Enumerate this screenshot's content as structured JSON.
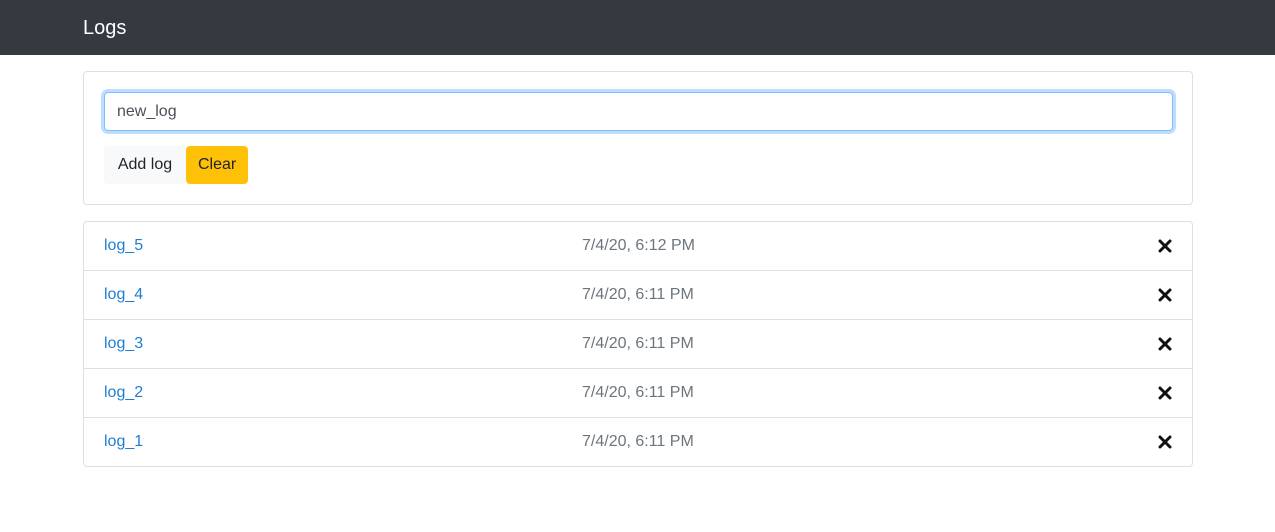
{
  "navbar": {
    "brand": "Logs"
  },
  "form": {
    "input_value": "new_log",
    "add_label": "Add log",
    "clear_label": "Clear"
  },
  "logs": [
    {
      "name": "log_5",
      "time": "7/4/20, 6:12 PM",
      "icon": "close-icon"
    },
    {
      "name": "log_4",
      "time": "7/4/20, 6:11 PM",
      "icon": "close-icon"
    },
    {
      "name": "log_3",
      "time": "7/4/20, 6:11 PM",
      "icon": "close-icon"
    },
    {
      "name": "log_2",
      "time": "7/4/20, 6:11 PM",
      "icon": "close-icon"
    },
    {
      "name": "log_1",
      "time": "7/4/20, 6:11 PM",
      "icon": "close-icon"
    }
  ],
  "colors": {
    "navbar": "#343a40",
    "link": "#1e7ed4",
    "clear_button": "#ffc107",
    "time_text": "#6c757d"
  }
}
